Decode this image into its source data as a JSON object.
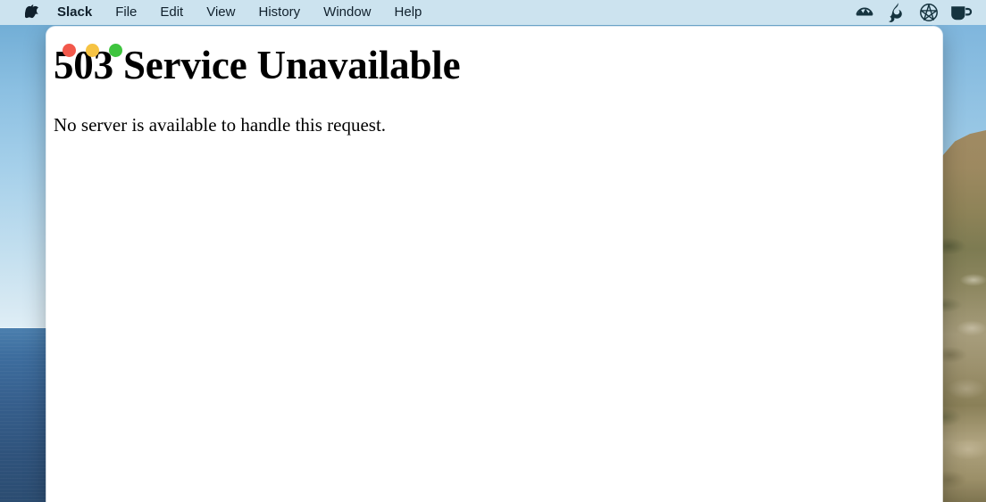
{
  "menubar": {
    "apple_icon": "apple-logo-icon",
    "app_name": "Slack",
    "items": [
      {
        "label": "File"
      },
      {
        "label": "Edit"
      },
      {
        "label": "View"
      },
      {
        "label": "History"
      },
      {
        "label": "Window"
      },
      {
        "label": "Help"
      }
    ],
    "status_icons": [
      {
        "name": "mountain-circle-icon"
      },
      {
        "name": "flame-droplet-icon"
      },
      {
        "name": "pentagram-circle-icon"
      },
      {
        "name": "coffee-mug-icon"
      }
    ],
    "background_color": "#cce3ef",
    "text_color": "#10202c"
  },
  "window": {
    "traffic_lights": [
      {
        "name": "close",
        "color": "#f2584b"
      },
      {
        "name": "minimize",
        "color": "#f6c343"
      },
      {
        "name": "maximize",
        "color": "#3ec43e"
      }
    ]
  },
  "page": {
    "heading": "503 Service Unavailable",
    "body": "No server is available to handle this request."
  },
  "desktop": {
    "sky_color": "#8cc0e2",
    "sea_color": "#3d6d9e",
    "hill_color": "#9d8960"
  }
}
